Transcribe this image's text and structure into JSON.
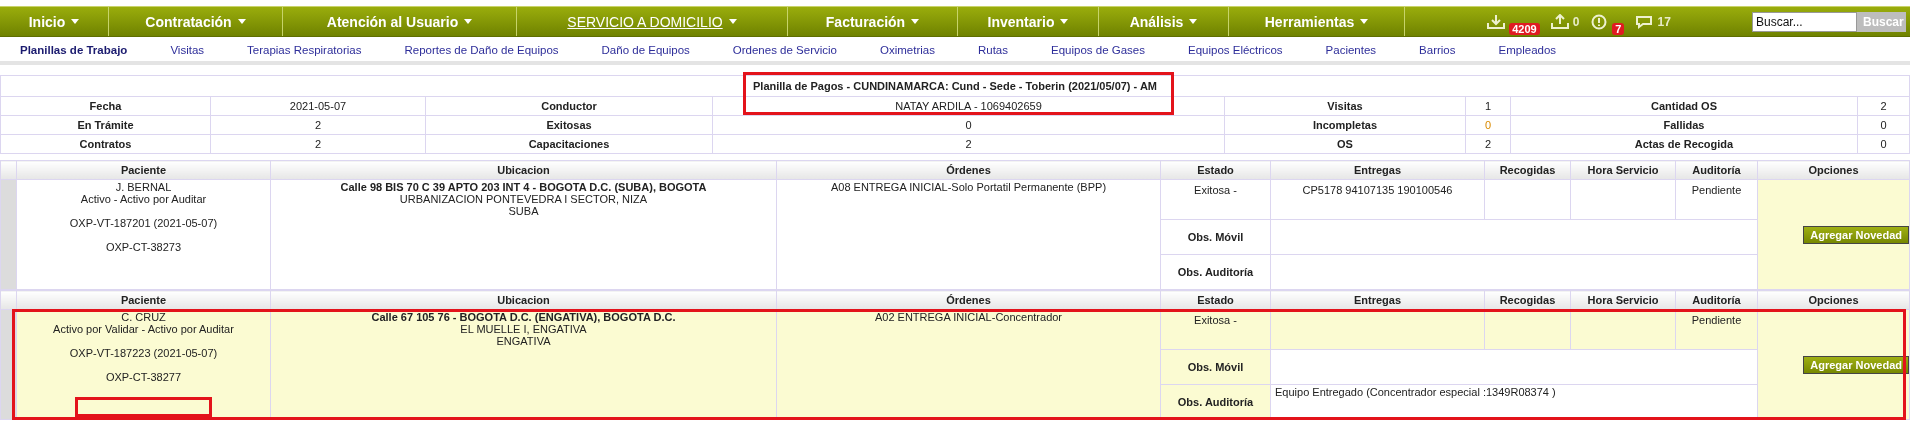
{
  "nav": {
    "menus": [
      {
        "label": "Inicio",
        "selected": false
      },
      {
        "label": "Contratación",
        "selected": false
      },
      {
        "label": "Atención al Usuario",
        "selected": false
      },
      {
        "label": "SERVICIO A DOMICILIO",
        "selected": true
      },
      {
        "label": "Facturación",
        "selected": false
      },
      {
        "label": "Inventario",
        "selected": false
      },
      {
        "label": "Análisis",
        "selected": false
      },
      {
        "label": "Herramientas",
        "selected": false
      }
    ],
    "notices": [
      {
        "kind": "download",
        "badge": "4209"
      },
      {
        "kind": "upload",
        "count": "0"
      },
      {
        "kind": "alert",
        "badge": "7"
      },
      {
        "kind": "chat",
        "count": "17"
      }
    ],
    "search": {
      "placeholder": "Buscar...",
      "button": "Buscar"
    }
  },
  "subnav": [
    {
      "label": "Planillas de Trabajo",
      "selected": true
    },
    {
      "label": "Visitas",
      "selected": false
    },
    {
      "label": "Terapias Respiratorias",
      "selected": false
    },
    {
      "label": "Reportes de Daño de Equipos",
      "selected": false
    },
    {
      "label": "Daño de Equipos",
      "selected": false
    },
    {
      "label": "Ordenes de Servicio",
      "selected": false
    },
    {
      "label": "Oximetrias",
      "selected": false
    },
    {
      "label": "Rutas",
      "selected": false
    },
    {
      "label": "Equipos de Gases",
      "selected": false
    },
    {
      "label": "Equipos Eléctricos",
      "selected": false
    },
    {
      "label": "Pacientes",
      "selected": false
    },
    {
      "label": "Barrios",
      "selected": false
    },
    {
      "label": "Empleados",
      "selected": false
    }
  ],
  "summary": {
    "title": "Planilla de Pagos - CUNDINAMARCA: Cund - Sede - Toberin (2021/05/07) - AM",
    "highlighted": true,
    "rows": [
      [
        {
          "label": "Fecha",
          "value": "2021-05-07",
          "alert": false
        },
        {
          "label": "Conductor",
          "value": "NATAY ARDILA - 1069402659",
          "alert": false
        },
        {
          "label": "Visitas",
          "value": "1",
          "alert": false
        },
        {
          "label": "Cantidad OS",
          "value": "2",
          "alert": false
        }
      ],
      [
        {
          "label": "En Trámite",
          "value": "2",
          "alert": false
        },
        {
          "label": "Exitosas",
          "value": "0",
          "alert": false
        },
        {
          "label": "Incompletas",
          "value": "0",
          "alert": true
        },
        {
          "label": "Fallidas",
          "value": "0",
          "alert": false
        }
      ],
      [
        {
          "label": "Contratos",
          "value": "2",
          "alert": false
        },
        {
          "label": "Capacitaciones",
          "value": "2",
          "alert": false
        },
        {
          "label": "OS",
          "value": "2",
          "alert": false
        },
        {
          "label": "Actas de Recogida",
          "value": "0",
          "alert": false
        }
      ]
    ]
  },
  "records": [
    {
      "highlighted": false,
      "columns": [
        "Paciente",
        "Ubicacion",
        "Órdenes",
        "Estado",
        "Entregas",
        "Recogidas",
        "Hora Servicio",
        "Auditoría",
        "Opciones"
      ],
      "patient": {
        "name": "J. BERNAL",
        "status": "Activo - Activo por Auditar",
        "codes": [
          "OXP-VT-187201 (2021-05-07)",
          "OXP-CT-38273"
        ],
        "flagged": false
      },
      "location": {
        "street": "Calle 98 BIS 70 C 39 APTO 203 INT 4 - BOGOTA D.C. (SUBA), BOGOTA",
        "lines": [
          "URBANIZACION PONTEVEDRA I SECTOR, NIZA",
          "SUBA"
        ]
      },
      "order": "A08 ENTREGA INICIAL-Solo Portatil Permanente (BPP)",
      "state": "Exitosa -",
      "deliveries": "CP5178 94107135 190100546",
      "audit": "Pendiente",
      "obs": [
        {
          "label": "Obs. Móvil"
        },
        {
          "label": "Obs. Auditoría"
        }
      ],
      "action": "Agregar Novedad"
    },
    {
      "highlighted": true,
      "columns": [
        "Paciente",
        "Ubicacion",
        "Órdenes",
        "Estado",
        "Entregas",
        "Recogidas",
        "Hora Servicio",
        "Auditoría",
        "Opciones"
      ],
      "patient": {
        "name": "C. CRUZ",
        "status": "Activo por Validar - Activo por Auditar",
        "codes": [
          "OXP-VT-187223 (2021-05-07)",
          "OXP-CT-38277"
        ],
        "flagged": true
      },
      "location": {
        "street": "Calle 67 105 76 - BOGOTA D.C. (ENGATIVA), BOGOTA D.C.",
        "lines": [
          "EL MUELLE I, ENGATIVA",
          "ENGATIVA"
        ]
      },
      "order": "A02 ENTREGA INICIAL-Concentrador",
      "state": "Exitosa -",
      "audit": "Pendiente",
      "obs": [
        {
          "label": "Obs. Móvil"
        },
        {
          "label": "Obs. Auditoría",
          "value": "Equipo Entregado (Concentrador especial :1349R08374 )"
        }
      ],
      "action": "Agregar Novedad"
    }
  ]
}
